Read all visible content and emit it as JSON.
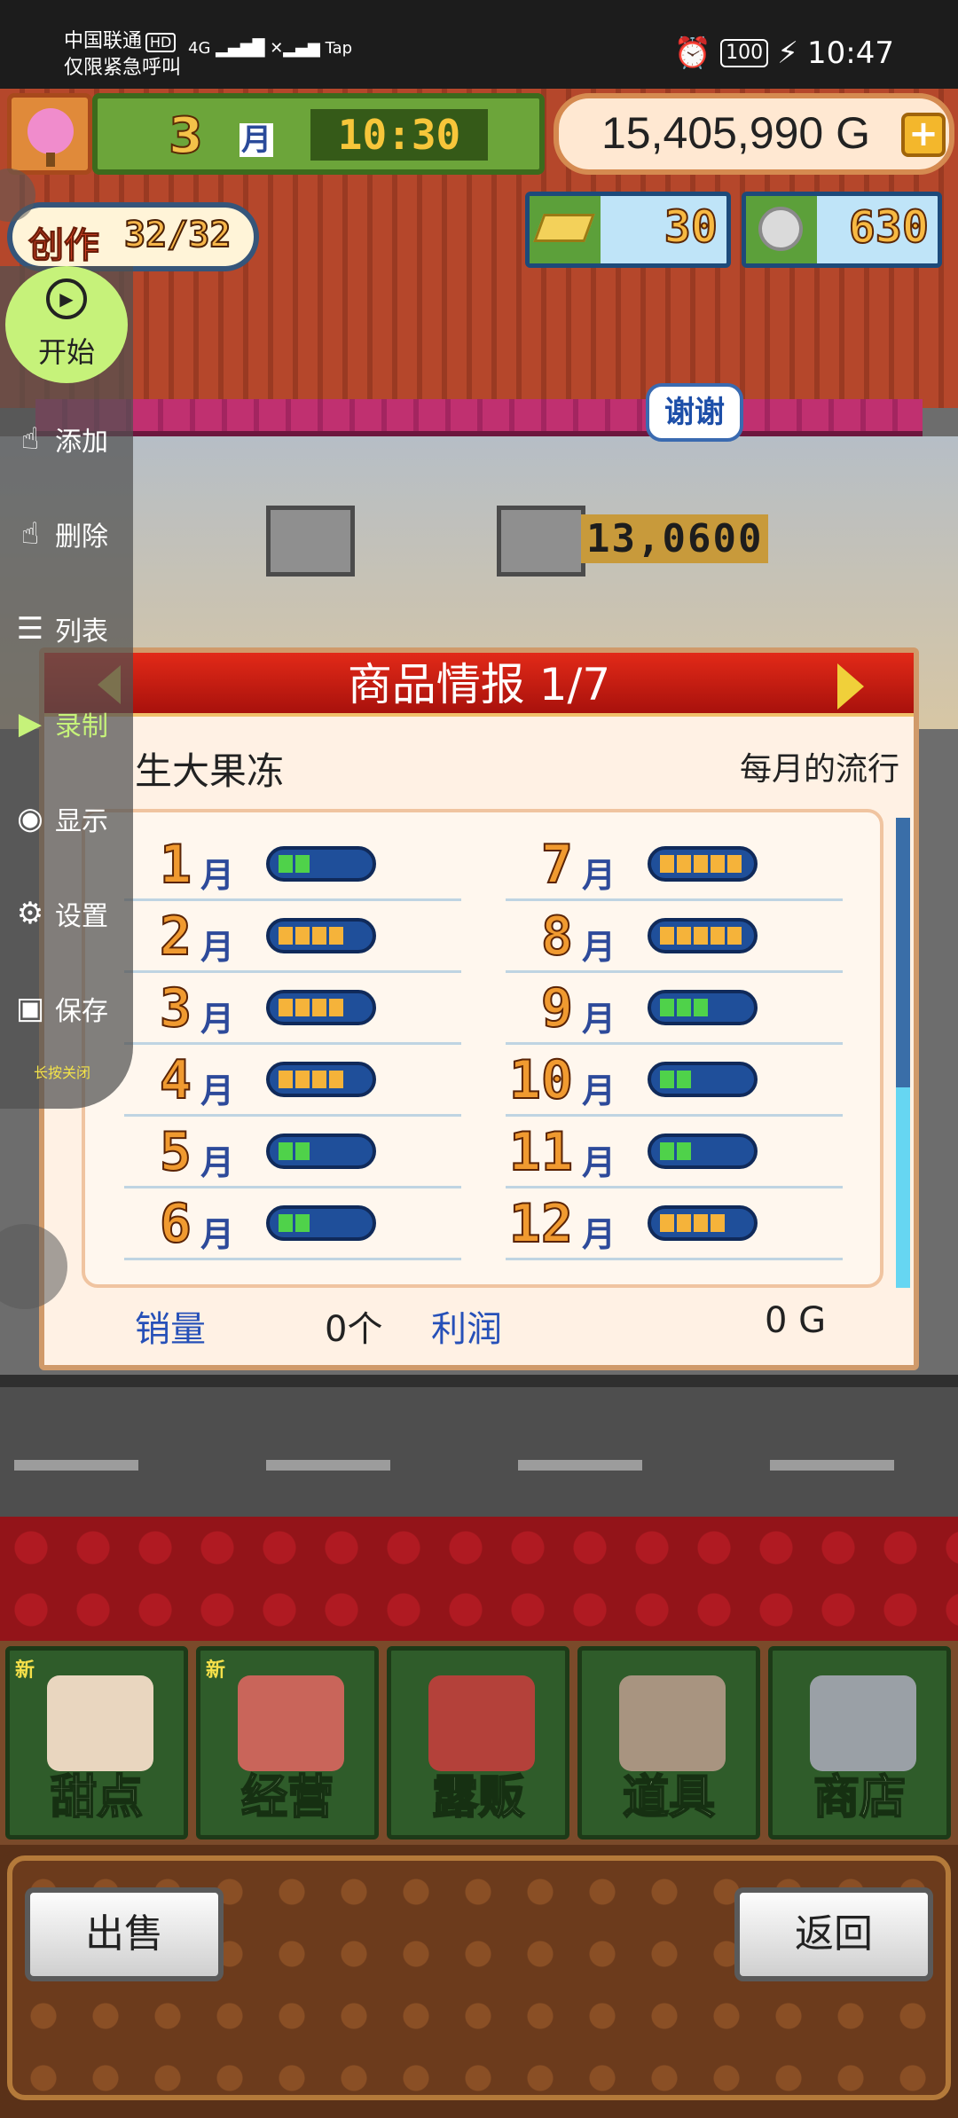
{
  "status_bar": {
    "carrier": "中国联通",
    "hd": "HD",
    "emergency": "仅限紧急呼叫",
    "signal": "4G",
    "extra": "Tap",
    "alarm_icon": "alarm-icon",
    "battery": "100",
    "time": "10:47"
  },
  "hud": {
    "month_num": "3",
    "month_unit": "月",
    "time": "10:30",
    "money": "15,405,990 G",
    "plus": "+",
    "creation_label": "创作",
    "creation_value": "32/32",
    "gold_tickets": "30",
    "silver_medals": "630"
  },
  "scene": {
    "bubble": "谢谢",
    "floating_number": "13,0600"
  },
  "panel": {
    "title": "商品情报 1/7",
    "product_name": "生大果冻",
    "trend_label": "每月的流行",
    "months": [
      {
        "num": "1",
        "unit": "月",
        "level": 2,
        "color": "#4fd24a"
      },
      {
        "num": "2",
        "unit": "月",
        "level": 4,
        "color": "#f5b33a"
      },
      {
        "num": "3",
        "unit": "月",
        "level": 4,
        "color": "#f5b33a"
      },
      {
        "num": "4",
        "unit": "月",
        "level": 4,
        "color": "#f5b33a"
      },
      {
        "num": "5",
        "unit": "月",
        "level": 2,
        "color": "#4fd24a"
      },
      {
        "num": "6",
        "unit": "月",
        "level": 2,
        "color": "#4fd24a"
      },
      {
        "num": "7",
        "unit": "月",
        "level": 5,
        "color": "#f5b33a"
      },
      {
        "num": "8",
        "unit": "月",
        "level": 5,
        "color": "#f5b33a"
      },
      {
        "num": "9",
        "unit": "月",
        "level": 3,
        "color": "#4fd24a"
      },
      {
        "num": "10",
        "unit": "月",
        "level": 2,
        "color": "#4fd24a"
      },
      {
        "num": "11",
        "unit": "月",
        "level": 2,
        "color": "#4fd24a"
      },
      {
        "num": "12",
        "unit": "月",
        "level": 4,
        "color": "#f5b33a"
      }
    ],
    "sales_label": "销量",
    "sales_value": "0个",
    "profit_label": "利润",
    "profit_value": "0 G"
  },
  "float_menu": {
    "start": "开始",
    "items": [
      {
        "label": "添加",
        "icon": "tap-add-icon",
        "glyph": "☝"
      },
      {
        "label": "删除",
        "icon": "tap-remove-icon",
        "glyph": "☝"
      },
      {
        "label": "列表",
        "icon": "list-icon",
        "glyph": "☰"
      },
      {
        "label": "录制",
        "icon": "record-icon",
        "glyph": "▶"
      },
      {
        "label": "显示",
        "icon": "eye-icon",
        "glyph": "◉"
      },
      {
        "label": "设置",
        "icon": "gear-icon",
        "glyph": "⚙"
      },
      {
        "label": "保存",
        "icon": "save-icon",
        "glyph": "▣"
      }
    ],
    "hint": "长按关闭",
    "active_color": "#c6f27a"
  },
  "bottom_nav": [
    {
      "label": "甜点",
      "new": "新",
      "icon": "cake-icon"
    },
    {
      "label": "经营",
      "new": "新",
      "icon": "shop-building-icon"
    },
    {
      "label": "露贩",
      "new": "",
      "icon": "food-truck-icon"
    },
    {
      "label": "道具",
      "new": "",
      "icon": "gear-bag-icon"
    },
    {
      "label": "商店",
      "new": "",
      "icon": "cart-icon"
    }
  ],
  "footer": {
    "sell": "出售",
    "back": "返回"
  }
}
